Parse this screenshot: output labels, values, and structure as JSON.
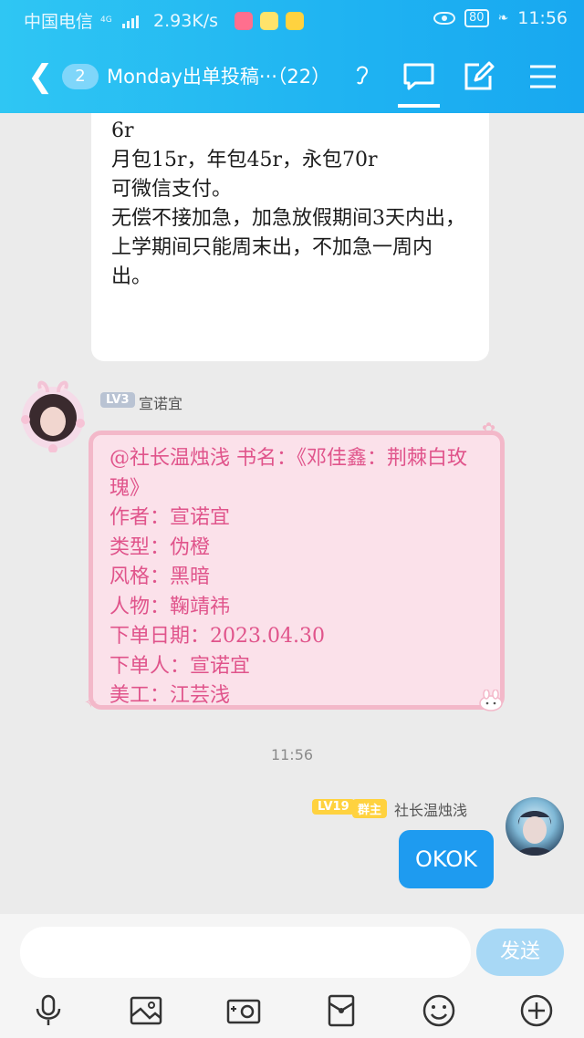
{
  "status_bar": {
    "carrier": "中国电信",
    "network": "4G",
    "speed": "2.93K/s",
    "battery": "80",
    "time": "11:56"
  },
  "nav": {
    "unread_count": "2",
    "title": "Monday出单投稿···（22）"
  },
  "messages": {
    "first_text": "6r\n月包15r，年包45r，永包70r\n可微信支付。\n无偿不接加急，加急放假期间3天内出，上学期间只能周末出，不加急一周内出。",
    "sender_a": {
      "level": "LV3",
      "name": "宣诺宜"
    },
    "pink_text": "@社长温烛浅 书名：《邓佳鑫：荆棘白玫瑰》\n作者：宣诺宜\n类型：伪橙\n风格：黑暗\n人物：鞠靖祎\n下单日期：2023.04.30\n下单人：宣诺宜\n美工：江芸浅",
    "timestamp": "11:56",
    "sender_b": {
      "level": "LV19",
      "role": "群主",
      "name": "社长温烛浅"
    },
    "reply_text": "OKOK"
  },
  "input": {
    "placeholder": "",
    "send_label": "发送"
  },
  "colors": {
    "header": "#1fb3f2",
    "bubble_blue": "#1e9bf0",
    "pink_text": "#e0548b"
  },
  "icons": {
    "toolbar": [
      "microphone-icon",
      "image-icon",
      "camera-icon",
      "red-packet-icon",
      "emoji-icon",
      "plus-icon"
    ]
  }
}
